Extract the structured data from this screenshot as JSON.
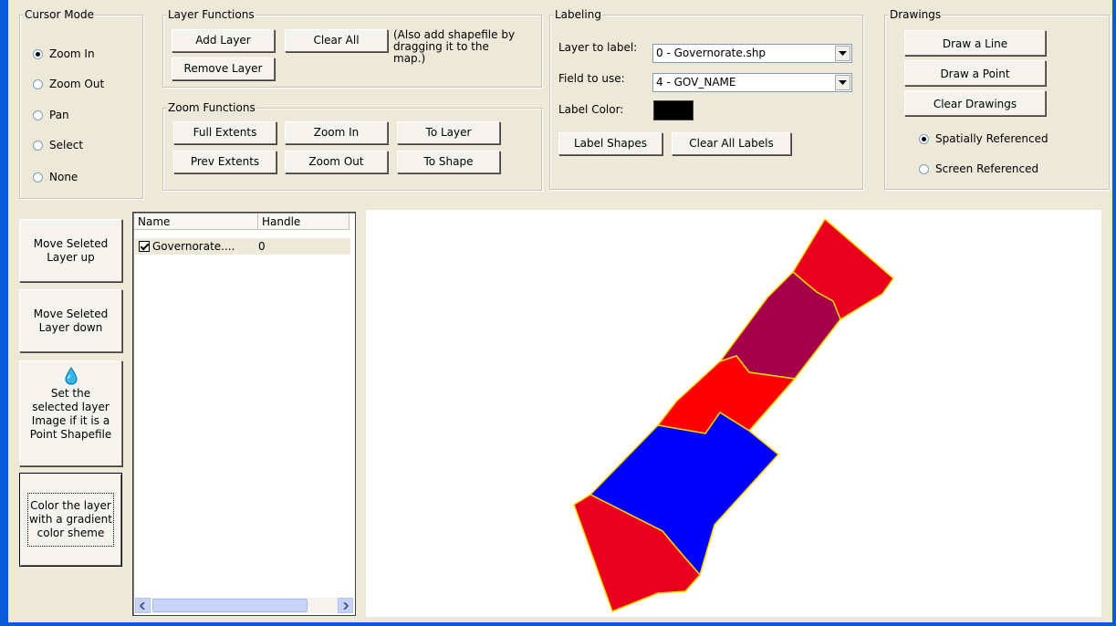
{
  "cursor_mode": {
    "title": "Cursor Mode",
    "options": [
      {
        "label": "Zoom In",
        "selected": true
      },
      {
        "label": "Zoom Out",
        "selected": false
      },
      {
        "label": "Pan",
        "selected": false
      },
      {
        "label": "Select",
        "selected": false
      },
      {
        "label": "None",
        "selected": false
      }
    ]
  },
  "layer_functions": {
    "title": "Layer Functions",
    "add_layer": "Add Layer",
    "clear_all": "Clear All",
    "remove_layer": "Remove Layer",
    "note": "(Also add shapefile by dragging it to the map.)"
  },
  "zoom_functions": {
    "title": "Zoom Functions",
    "full_extents": "Full Extents",
    "zoom_in": "Zoom In",
    "to_layer": "To Layer",
    "prev_extents": "Prev Extents",
    "zoom_out": "Zoom Out",
    "to_shape": "To Shape"
  },
  "labeling": {
    "title": "Labeling",
    "layer_to_label_label": "Layer to label:",
    "layer_to_label_value": "0 - Governorate.shp",
    "field_to_use_label": "Field to use:",
    "field_to_use_value": "4 - GOV_NAME",
    "label_color_label": "Label Color:",
    "label_color": "#000000",
    "label_shapes": "Label Shapes",
    "clear_all_labels": "Clear All Labels"
  },
  "drawings": {
    "title": "Drawings",
    "draw_line": "Draw a Line",
    "draw_point": "Draw a Point",
    "clear_drawings": "Clear Drawings",
    "spatially_referenced": "Spatially Referenced",
    "screen_referenced": "Screen Referenced",
    "selected": "Spatially Referenced"
  },
  "side_buttons": {
    "move_up_line1": "Move Seleted",
    "move_up_line2": "Layer up",
    "move_down_line1": "Move Seleted",
    "move_down_line2": "Layer down",
    "set_image_line1": "Set the",
    "set_image_line2": "selected layer",
    "set_image_line3": "Image if it is a",
    "set_image_line4": "Point Shapefile",
    "gradient_line1": "Color the layer",
    "gradient_line2": "with a gradient",
    "gradient_line3": "color sheme"
  },
  "layer_list": {
    "columns": [
      "Name",
      "Handle"
    ],
    "rows": [
      {
        "name": "Governorate....",
        "handle": "0",
        "checked": true
      }
    ]
  },
  "map": {
    "colors": {
      "red": "#e8001c",
      "bright_red": "#ff0000",
      "maroon": "#a5004a",
      "blue": "#0000ff",
      "outline": "#ffd700"
    }
  }
}
